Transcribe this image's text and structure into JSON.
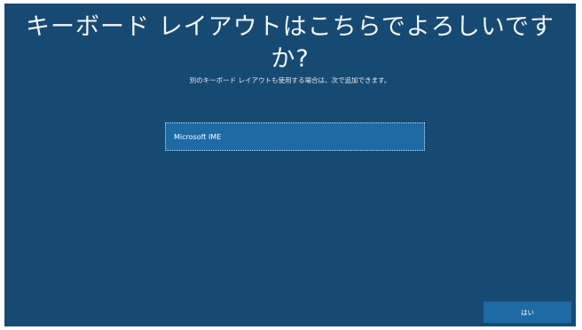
{
  "page": {
    "title_line1": "キーボード レイアウトはこちらでよろしいです",
    "title_line2": "か?",
    "subtitle": "別のキーボード レイアウトも使用する場合は、次で追加できます。"
  },
  "layouts": {
    "items": [
      {
        "label": "Microsoft IME",
        "selected": true
      }
    ]
  },
  "actions": {
    "yes_label": "はい"
  },
  "colors": {
    "background": "#174a72",
    "accent": "#1d6aa5",
    "text": "#ffffff"
  }
}
